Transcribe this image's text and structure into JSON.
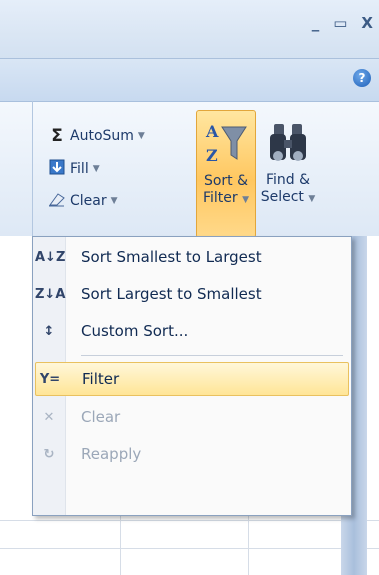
{
  "window": {
    "controls": [
      "_",
      "▭",
      "X"
    ],
    "help_icon": "?"
  },
  "ribbon": {
    "autosum": {
      "symbol": "Σ",
      "label": "AutoSum"
    },
    "fill": {
      "label": "Fill"
    },
    "clear": {
      "label": "Clear"
    },
    "sort_filter": {
      "line1": "Sort &",
      "line2": "Filter"
    },
    "find_select": {
      "line1": "Find &",
      "line2": "Select"
    }
  },
  "menu": {
    "items": [
      {
        "icon": "A↓Z",
        "label": "Sort Smallest to Largest",
        "enabled": true
      },
      {
        "icon": "Z↓A",
        "label": "Sort Largest to Smallest",
        "enabled": true
      },
      {
        "icon": "↕",
        "label": "Custom Sort...",
        "enabled": true
      },
      {
        "icon": "Y=",
        "label": "Filter",
        "enabled": true,
        "highlighted": true
      },
      {
        "icon": "✕",
        "label": "Clear",
        "enabled": false
      },
      {
        "icon": "↻",
        "label": "Reapply",
        "enabled": false
      }
    ]
  }
}
